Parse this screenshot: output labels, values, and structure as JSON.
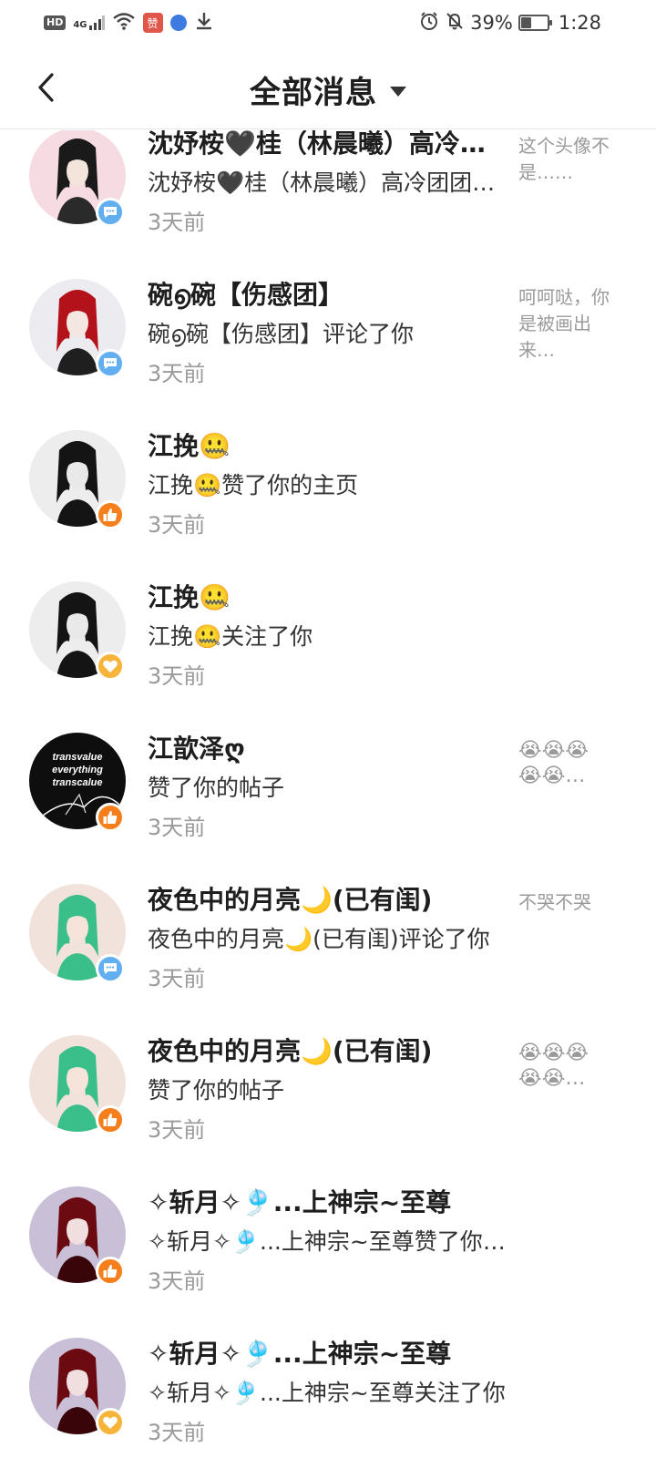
{
  "status_bar": {
    "hd": "HD",
    "network": "4G",
    "app_badge": "赞",
    "battery": "39%",
    "battery_level": 0.39,
    "time": "1:28"
  },
  "header": {
    "title": "全部消息"
  },
  "messages": [
    {
      "name": "沈妤桉🖤桂（林晨曦）高冷团团长",
      "action": "沈妤桉🖤桂（林晨曦）高冷团团长评论了你",
      "time": "3天前",
      "snippet": "这个头像不是……",
      "badge": "comment"
    },
    {
      "name": "碗൭碗【伤感团】",
      "action": "碗൭碗【伤感团】评论了你",
      "time": "3天前",
      "snippet": "呵呵哒，你是被画出来…",
      "badge": "comment"
    },
    {
      "name": "江挽🤐",
      "action": "江挽🤐赞了你的主页",
      "time": "3天前",
      "snippet": "",
      "badge": "like"
    },
    {
      "name": "江挽🤐",
      "action": "江挽🤐关注了你",
      "time": "3天前",
      "snippet": "",
      "badge": "follow"
    },
    {
      "name": "江歆泽ღ",
      "action": "赞了你的帖子",
      "time": "3天前",
      "snippet": "😭😭😭😭😭…",
      "badge": "like",
      "avatar_text": [
        "transvalue",
        "everything",
        "transcalue"
      ]
    },
    {
      "name": "夜色中的月亮🌙(已有闺)",
      "action": "夜色中的月亮🌙(已有闺)评论了你",
      "time": "3天前",
      "snippet": "不哭不哭",
      "badge": "comment"
    },
    {
      "name": "夜色中的月亮🌙(已有闺)",
      "action": "赞了你的帖子",
      "time": "3天前",
      "snippet": "😭😭😭😭😭…",
      "badge": "like"
    },
    {
      "name": "✧斩月✧🎐...上神宗~至尊",
      "action": "✧斩月✧🎐...上神宗~至尊赞了你的帖子",
      "time": "3天前",
      "snippet": "",
      "badge": "like"
    },
    {
      "name": "✧斩月✧🎐...上神宗~至尊",
      "action": "✧斩月✧🎐...上神宗~至尊关注了你",
      "time": "3天前",
      "snippet": "",
      "badge": "follow"
    }
  ],
  "colors": {
    "comment_badge": "#61aef0",
    "like_badge": "#f47f1c",
    "follow_badge": "#f7b43a"
  }
}
